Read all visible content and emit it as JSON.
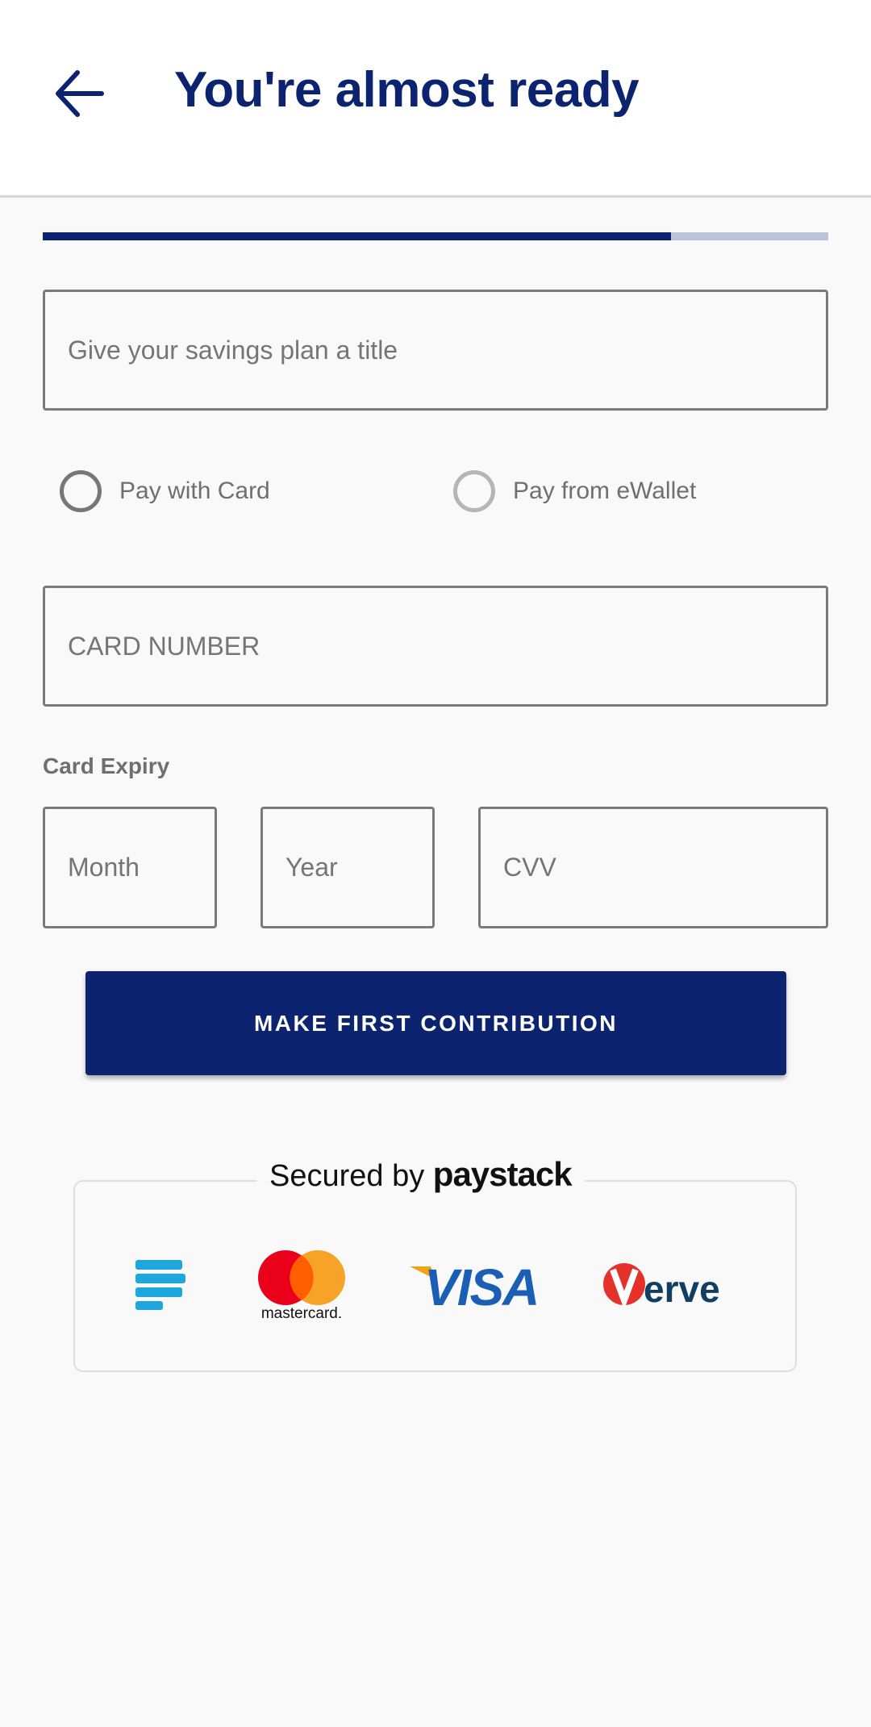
{
  "header": {
    "title": "You're almost ready",
    "back_icon": "arrow-left-icon"
  },
  "progress": {
    "percent": 80,
    "fill_color": "#0c2470",
    "track_color": "#b9c3d9"
  },
  "form": {
    "title_placeholder": "Give your savings plan a title",
    "payment_options": [
      {
        "label": "Pay with Card",
        "selected": false
      },
      {
        "label": "Pay from eWallet",
        "selected": false
      }
    ],
    "card_number_placeholder": "CARD NUMBER",
    "expiry_label": "Card Expiry",
    "month_placeholder": "Month",
    "year_placeholder": "Year",
    "cvv_placeholder": "CVV",
    "submit_label": "MAKE FIRST CONTRIBUTION"
  },
  "secured": {
    "prefix": "Secured by",
    "brand": "paystack",
    "logos": [
      "paystack",
      "mastercard",
      "visa",
      "verve"
    ],
    "mastercard_text": "mastercard.",
    "visa_text": "VISA",
    "verve_text": "erve"
  },
  "colors": {
    "primary": "#0c2470"
  }
}
